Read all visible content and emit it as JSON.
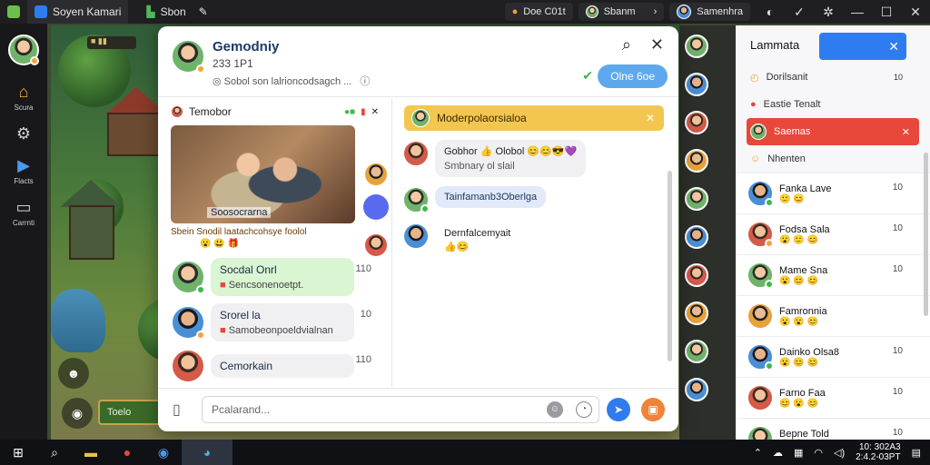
{
  "titlebar": {
    "app_title": "Soyen Kamari",
    "tab2": "Sbon",
    "pill1": "Doe C01t",
    "pill2": "Sbanm",
    "pill3": "Samenhra"
  },
  "sidebar": {
    "items": [
      {
        "label": "Scura",
        "icon": "home-icon"
      },
      {
        "label": "",
        "icon": "gear-icon"
      },
      {
        "label": "Flacts",
        "icon": "play-icon"
      },
      {
        "label": "Carrnti",
        "icon": "screen-icon"
      }
    ],
    "game_pill": "Toelo"
  },
  "chat": {
    "title": "Gemodniy",
    "subtitle": "233 1P1",
    "status": "Sobol son lalrioncodsagch ...",
    "follow_button": "Olne 6oe",
    "search_hint": "Pcalarand..."
  },
  "list_pane": {
    "section_title": "Temobor",
    "photo_caption": "Soosocrarna",
    "caption_line": "Sbein  Snodil laatachcohsye foolol",
    "conversations": [
      {
        "name": "Socdal Onrl",
        "preview": "Sencsonenoetpt.",
        "count": "110",
        "bg": "#d9f5d1"
      },
      {
        "name": "Srorel la",
        "preview": "Samobeonpoeldvialnan",
        "count": "10",
        "bg": "#f0f0f2"
      },
      {
        "name": "Cemorkain",
        "preview": "",
        "count": "110",
        "bg": "#f0f0f2"
      }
    ]
  },
  "messages": {
    "banner": "Moderpolaorsialoa",
    "items": [
      {
        "name": "Gobhor",
        "extra": "Olobol",
        "text": "Smbnary ol slail",
        "bg": "#f0f0f2"
      },
      {
        "name": "",
        "extra": "",
        "text": "Tainfamanb3Oberlga",
        "bg": "#e2eaf9"
      },
      {
        "name": "Dernfalcemyait",
        "extra": "",
        "text": "",
        "bg": "transparent"
      }
    ]
  },
  "contacts": {
    "title": "Lammata",
    "filters": [
      "Dorilsanit",
      "Eastie Tenalt",
      "Saemas",
      "Nhenten"
    ],
    "rows": [
      {
        "name": "Fanka Lave",
        "count": "10"
      },
      {
        "name": "Fodsa Sala",
        "count": "10"
      },
      {
        "name": "Mame Sna",
        "count": "10"
      },
      {
        "name": "Famronnia",
        "count": ""
      },
      {
        "name": "Dainko Olsa8",
        "count": "10"
      },
      {
        "name": "Farno Faa",
        "count": "10"
      },
      {
        "name": "Bepne Told",
        "count": "10"
      }
    ],
    "filter_counts": [
      "10",
      "",
      "",
      ""
    ]
  },
  "taskbar": {
    "clock_time": "10: 302A3",
    "clock_date": "2:4.2-03PT"
  },
  "colors": {
    "accent_blue": "#2f7cf0",
    "active_red": "#e8483a",
    "banner_yellow": "#f3c64f"
  }
}
